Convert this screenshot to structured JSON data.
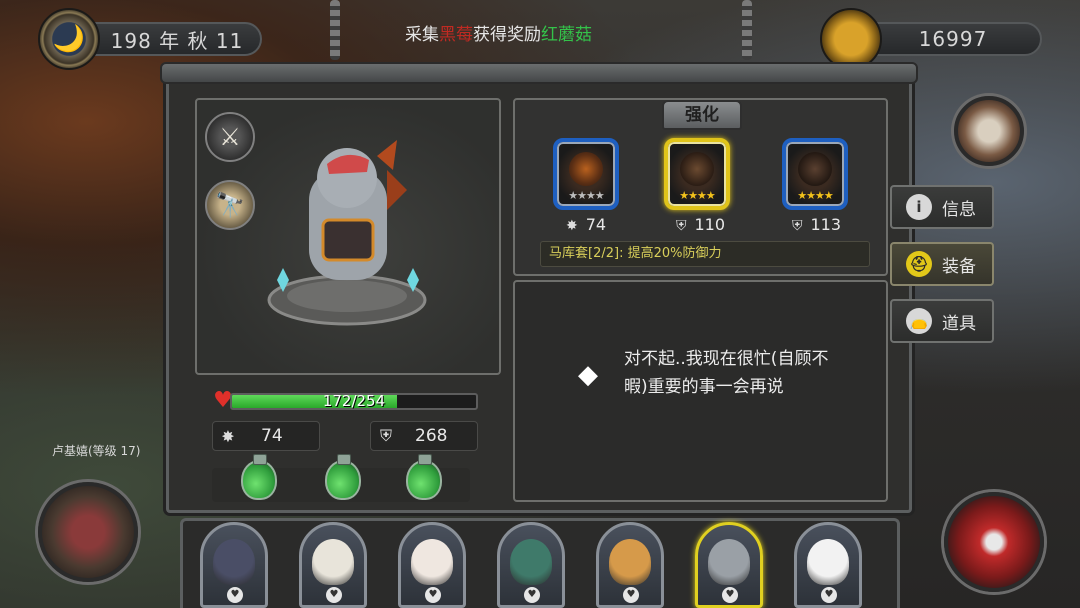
{
  "hud": {
    "date": "198 年 秋 11",
    "gold": "16997"
  },
  "quest": {
    "prefix": "采集",
    "target": "黑莓",
    "mid": "获得奖励",
    "reward": "红蘑菇"
  },
  "character": {
    "hp_text": "172/254",
    "hp_fraction": 0.677,
    "attack": "74",
    "defense": "268"
  },
  "strengthen_label": "强化",
  "gear": [
    {
      "stars": "★★★★",
      "star_color": "silver",
      "icon": "attack-icon",
      "value": "74"
    },
    {
      "stars": "★★★★",
      "star_color": "gold",
      "icon": "shield-icon",
      "value": "110",
      "selected": true
    },
    {
      "stars": "★★★★",
      "star_color": "gold",
      "icon": "shield-icon",
      "value": "113"
    }
  ],
  "set_bonus": "马库套[2/2]: 提高20%防御力",
  "dialog": {
    "line1": "对不起..我现在很忙(自顾不",
    "line2": "暇)重要的事一会再说"
  },
  "side_tabs": [
    {
      "label": "信息",
      "icon": "info-icon",
      "glyph": "i"
    },
    {
      "label": "装备",
      "icon": "helmet-icon",
      "glyph": "⛑",
      "active": true
    },
    {
      "label": "道具",
      "icon": "bag-icon",
      "glyph": "👝"
    }
  ],
  "left_hero_label": "卢基嬉(等级 17)",
  "roster": [
    {
      "name": "bull",
      "color": "#4a4e66"
    },
    {
      "name": "eagle",
      "color": "#e8e4da"
    },
    {
      "name": "alpaca",
      "color": "#efe7e0"
    },
    {
      "name": "crocodile",
      "color": "#3f7a6a"
    },
    {
      "name": "giraffe",
      "color": "#d69a4a"
    },
    {
      "name": "elephant",
      "color": "#9aa0a6",
      "selected": true
    },
    {
      "name": "polar-bear",
      "color": "#f2f2f2"
    }
  ]
}
